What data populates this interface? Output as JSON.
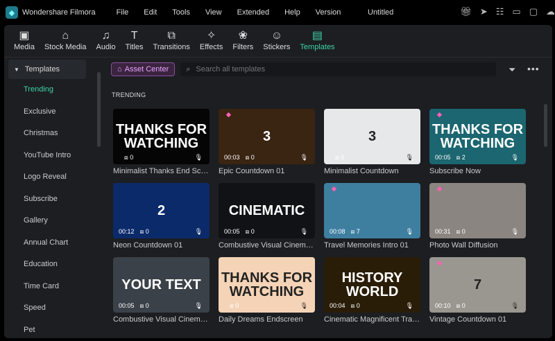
{
  "app": {
    "name": "Wondershare Filmora",
    "document": "Untitled",
    "menu": [
      "File",
      "Edit",
      "Tools",
      "View",
      "Extended",
      "Help",
      "Version"
    ]
  },
  "toolbar": [
    {
      "label": "Media",
      "icon": "▣"
    },
    {
      "label": "Stock Media",
      "icon": "⌂"
    },
    {
      "label": "Audio",
      "icon": "♫"
    },
    {
      "label": "Titles",
      "icon": "T"
    },
    {
      "label": "Transitions",
      "icon": "⧉"
    },
    {
      "label": "Effects",
      "icon": "✧"
    },
    {
      "label": "Filters",
      "icon": "❀"
    },
    {
      "label": "Stickers",
      "icon": "☺"
    },
    {
      "label": "Templates",
      "icon": "▤",
      "active": true
    }
  ],
  "sidebar": {
    "header": "Templates",
    "items": [
      "Trending",
      "Exclusive",
      "Christmas",
      "YouTube Intro",
      "Logo Reveal",
      "Subscribe",
      "Gallery",
      "Annual Chart",
      "Education",
      "Time Card",
      "Speed",
      "Pet"
    ],
    "active": "Trending"
  },
  "asset_center": "Asset Center",
  "search": {
    "placeholder": "Search all templates"
  },
  "section": "TRENDING",
  "cards": [
    {
      "title": "Minimalist Thanks End Screen",
      "duration": "",
      "count": "0",
      "premium": false,
      "thumb_text": "THANKS FOR WATCHING",
      "bg": "#050505"
    },
    {
      "title": "Epic Countdown 01",
      "duration": "00:03",
      "count": "0",
      "premium": true,
      "thumb_text": "3",
      "bg": "#3a2412"
    },
    {
      "title": "Minimalist Countdown",
      "duration": "",
      "count": "0",
      "premium": false,
      "thumb_text": "3",
      "bg": "#e6e8ea"
    },
    {
      "title": "Subscribe Now",
      "duration": "00:05",
      "count": "2",
      "premium": true,
      "thumb_text": "THANKS FOR WATCHING",
      "bg": "#1b6670"
    },
    {
      "title": "Neon Countdown 01",
      "duration": "00:12",
      "count": "0",
      "premium": false,
      "thumb_text": "2",
      "bg": "#0b2a6a"
    },
    {
      "title": "Combustive Visual Cinemati...",
      "duration": "00:05",
      "count": "0",
      "premium": false,
      "thumb_text": "CINEMATIC",
      "bg": "#101215"
    },
    {
      "title": "Travel Memories Intro 01",
      "duration": "00:08",
      "count": "7",
      "premium": true,
      "thumb_text": "",
      "bg": "#3e7fa0"
    },
    {
      "title": "Photo Wall Diffusion",
      "duration": "00:31",
      "count": "0",
      "premium": true,
      "thumb_text": "",
      "bg": "#8a8580"
    },
    {
      "title": "Combustive Visual Cinemati...",
      "duration": "00:05",
      "count": "0",
      "premium": false,
      "thumb_text": "YOUR TEXT",
      "bg": "#3b4148"
    },
    {
      "title": "Daily Dreams Endscreen",
      "duration": "",
      "count": "0",
      "premium": false,
      "thumb_text": "THANKS FOR WATCHING",
      "bg": "#f4d3b6"
    },
    {
      "title": "Cinematic Magnificent Traile...",
      "duration": "00:04",
      "count": "0",
      "premium": false,
      "thumb_text": "HISTORY WORLD",
      "bg": "#2a1d08"
    },
    {
      "title": "Vintage Countdown 01",
      "duration": "00:10",
      "count": "0",
      "premium": true,
      "thumb_text": "7",
      "bg": "#9a9690"
    }
  ]
}
